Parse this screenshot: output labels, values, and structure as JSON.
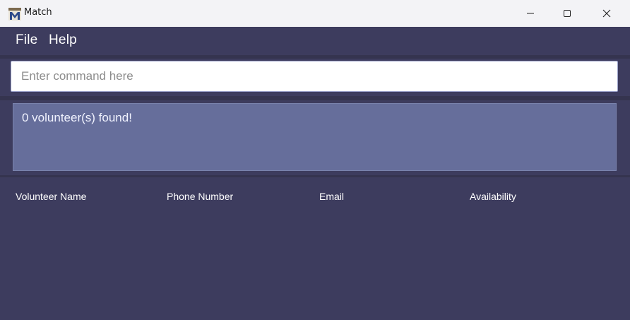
{
  "window": {
    "title": "Match",
    "icon": "match-logo-icon",
    "controls": [
      "minimize-icon",
      "maximize-icon",
      "close-icon"
    ]
  },
  "menubar": {
    "items": [
      "File",
      "Help"
    ]
  },
  "command": {
    "value": "",
    "placeholder": "Enter command here"
  },
  "result": {
    "text": "0 volunteer(s) found!"
  },
  "table": {
    "columns": [
      "Volunteer Name",
      "Phone Number",
      "Email",
      "Availability"
    ],
    "rows": []
  },
  "colors": {
    "background": "#3d3c5e",
    "result_panel": "#666e9b",
    "titlebar": "#f3f3f6"
  }
}
